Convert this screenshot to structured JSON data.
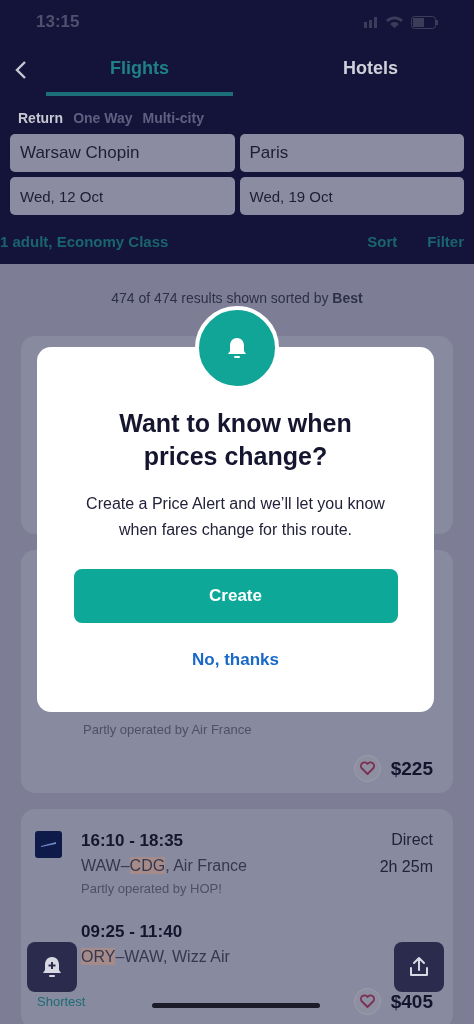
{
  "status_bar": {
    "time": "13:15"
  },
  "tabs": [
    {
      "label": "Flights",
      "selected": true
    },
    {
      "label": "Hotels",
      "selected": false
    }
  ],
  "trip_types": [
    {
      "label": "Return",
      "selected": true
    },
    {
      "label": "One Way",
      "selected": false
    },
    {
      "label": "Multi-city",
      "selected": false
    }
  ],
  "search": {
    "origin": "Warsaw Chopin",
    "destination": "Paris",
    "depart_date": "Wed, 12 Oct",
    "return_date": "Wed, 19 Oct"
  },
  "passengers": "1 adult, Economy Class",
  "actions": [
    "Sort",
    "Filter"
  ],
  "results_summary": "474 of 474 results shown sorted by **Best**",
  "results": [
    {
      "note": "Partly operated by Air France",
      "price": "$225"
    },
    {
      "legs": [
        {
          "logo": true,
          "times": "16:10 - 18:35",
          "route": [
            {
              "text": "WAW–",
              "highlighted": false
            },
            {
              "text": "CDG",
              "highlighted": true
            },
            {
              "text": ", Air France",
              "highlighted": false
            }
          ],
          "stops": "Direct",
          "duration": "2h 25m",
          "note": "Partly operated by HOP!"
        },
        {
          "logo": false,
          "times": "09:25 - 11:40",
          "route": [
            {
              "text": "ORY",
              "highlighted": true
            },
            {
              "text": "–WAW, Wizz Air",
              "highlighted": false
            }
          ]
        }
      ],
      "tag": "Shortest",
      "price": "$405"
    }
  ],
  "dialog": {
    "title": "Want to know when prices change?",
    "body": "Create a Price Alert and we’ll let you know when fares change for this route.",
    "primary": "Create",
    "secondary": "No, thanks"
  }
}
